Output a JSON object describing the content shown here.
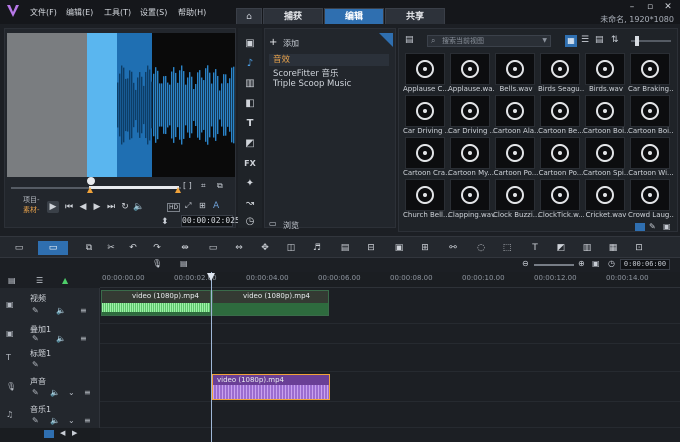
{
  "menu": [
    "文件(F)",
    "编辑(E)",
    "工具(T)",
    "设置(S)",
    "帮助(H)"
  ],
  "tabs": {
    "capture": "捕获",
    "edit": "编辑",
    "share": "共享"
  },
  "project_info": "未命名, 1920*1080",
  "preview": {
    "labels": {
      "project": "项目-",
      "clip": "素材-"
    },
    "timecode": "00:00:02:025",
    "hd": "HD"
  },
  "library": {
    "add_label": "添加",
    "browse_label": "浏览",
    "categories": [
      "音效",
      "ScoreFitter 音乐",
      "Triple Scoop Music"
    ],
    "search_placeholder": "搜索当前视图",
    "items": [
      "Applause C...",
      "Applause.wa...",
      "Bells.wav",
      "Birds Seagu...",
      "Birds.wav",
      "Car Braking...",
      "Car Driving ...",
      "Car Driving ...",
      "Cartoon Ala...",
      "Cartoon Be...",
      "Cartoon Boi...",
      "Cartoon Boi...",
      "Cartoon Cra...",
      "Cartoon My...",
      "Cartoon Po...",
      "Cartoon Po...",
      "Cartoon Spi...",
      "Cartoon Wi...",
      "Church Bell...",
      "Clapping.wav",
      "Clock Buzzi...",
      "ClockTick.w...",
      "Cricket.wav",
      "Crowd Laug..."
    ]
  },
  "toolbar": {
    "zoom_time": "0:00:06:00"
  },
  "ruler": [
    "00:00:00.00",
    "00:00:02.00",
    "00:00:04.00",
    "00:00:06.00",
    "00:00:08.00",
    "00:00:10.00",
    "00:00:12.00",
    "00:00:14.00"
  ],
  "tracks": [
    "视频",
    "叠加1",
    "标题1",
    "声音",
    "音乐1"
  ],
  "clips": {
    "video1": "video (1080p).mp4",
    "video2": "video (1080p).mp4",
    "audio": "video (1080p).mp4"
  },
  "colors": {
    "accent": "#2f6fb0",
    "selected_category": "#e8a24b",
    "video_clip": "#2e6b3e",
    "audio_clip": "#6a3f96"
  }
}
